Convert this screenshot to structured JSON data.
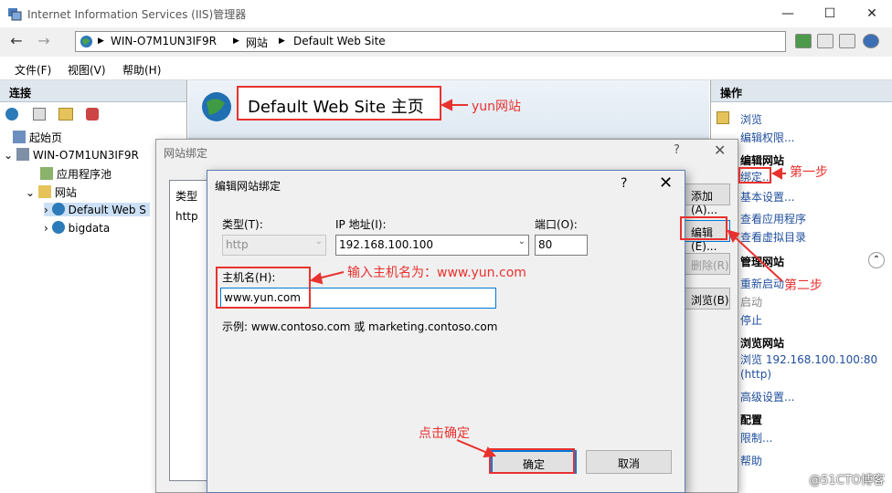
{
  "window": {
    "title": "Internet Information Services (IIS)管理器",
    "minimize": "—",
    "maximize": "☐",
    "close": "✕"
  },
  "address": {
    "crumbs": [
      "WIN-O7M1UN3IF9R",
      "网站",
      "Default Web Site"
    ],
    "separator": "▶"
  },
  "menu": [
    "文件(F)",
    "视图(V)",
    "帮助(H)"
  ],
  "connections": {
    "title": "连接",
    "tree": [
      {
        "label": "起始页",
        "expander": ""
      },
      {
        "label": "WIN-O7M1UN3IF9R",
        "expander": "⌄"
      },
      {
        "label": "应用程序池",
        "expander": ""
      },
      {
        "label": "网站",
        "expander": "⌄"
      },
      {
        "label": "Default Web S",
        "expander": "›"
      },
      {
        "label": "bigdata",
        "expander": "›"
      }
    ]
  },
  "home": {
    "title": "Default Web Site 主页"
  },
  "actions": {
    "title": "操作",
    "items": [
      {
        "text": "浏览",
        "kind": "link"
      },
      {
        "text": "编辑权限...",
        "kind": "link"
      },
      {
        "text": "编辑网站",
        "kind": "head"
      },
      {
        "text": "绑定...",
        "kind": "link"
      },
      {
        "text": "基本设置...",
        "kind": "link"
      },
      {
        "text": "查看应用程序",
        "kind": "link"
      },
      {
        "text": "查看虚拟目录",
        "kind": "link"
      },
      {
        "text": "管理网站",
        "kind": "head"
      },
      {
        "text": "重新启动",
        "kind": "link"
      },
      {
        "text": "启动",
        "kind": "link"
      },
      {
        "text": "停止",
        "kind": "link"
      },
      {
        "text": "浏览网站",
        "kind": "head"
      },
      {
        "text": "浏览 192.168.100.100:80",
        "kind": "link"
      },
      {
        "text": "(http)",
        "kind": "link"
      },
      {
        "text": "高级设置...",
        "kind": "link"
      },
      {
        "text": "配置",
        "kind": "head"
      },
      {
        "text": "限制...",
        "kind": "link"
      },
      {
        "text": "帮助",
        "kind": "link"
      }
    ]
  },
  "bindings_dialog": {
    "title": "网站绑定",
    "help": "?",
    "close": "✕",
    "column_type": "类型",
    "row_type": "http",
    "buttons": [
      "添加(A)...",
      "编辑(E)...",
      "删除(R)",
      "浏览(B)"
    ]
  },
  "edit_dialog": {
    "title": "编辑网站绑定",
    "help": "?",
    "close": "✕",
    "type_label": "类型(T):",
    "type_value": "http",
    "ip_label": "IP 地址(I):",
    "ip_value": "192.168.100.100",
    "port_label": "端口(O):",
    "port_value": "80",
    "host_label": "主机名(H):",
    "host_value": "www.yun.com",
    "example": "示例: www.contoso.com 或 marketing.contoso.com",
    "ok": "确定",
    "cancel": "取消"
  },
  "annotations": {
    "site_note": "yun网站",
    "step1": "第一步",
    "step2": "第二步",
    "host_note": "输入主机名为：www.yun.com",
    "ok_note": "点击确定",
    "color": "#e8322f"
  },
  "watermark": "@51CTO博客"
}
